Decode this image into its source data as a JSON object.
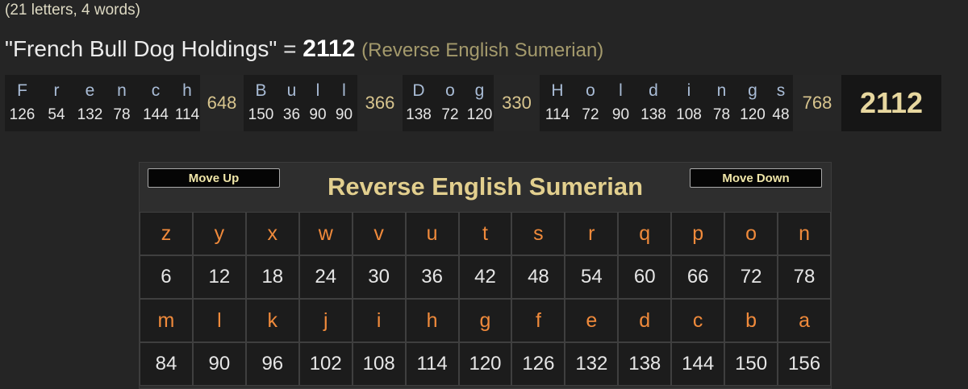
{
  "meta_text": "(21 letters, 4 words)",
  "phrase": {
    "quoted": "\"French Bull Dog Holdings\"",
    "equals": "=",
    "total": "2112",
    "cipher_label": "(Reverse English Sumerian)"
  },
  "breakdown": {
    "words": [
      {
        "letters": [
          {
            "ch": "F",
            "val": "126"
          },
          {
            "ch": "r",
            "val": "54"
          },
          {
            "ch": "e",
            "val": "132"
          },
          {
            "ch": "n",
            "val": "78"
          },
          {
            "ch": "c",
            "val": "144"
          },
          {
            "ch": "h",
            "val": "114"
          }
        ],
        "sum": "648"
      },
      {
        "letters": [
          {
            "ch": "B",
            "val": "150"
          },
          {
            "ch": "u",
            "val": "36"
          },
          {
            "ch": "l",
            "val": "90"
          },
          {
            "ch": "l",
            "val": "90"
          }
        ],
        "sum": "366"
      },
      {
        "letters": [
          {
            "ch": "D",
            "val": "138"
          },
          {
            "ch": "o",
            "val": "72"
          },
          {
            "ch": "g",
            "val": "120"
          }
        ],
        "sum": "330"
      },
      {
        "letters": [
          {
            "ch": "H",
            "val": "114"
          },
          {
            "ch": "o",
            "val": "72"
          },
          {
            "ch": "l",
            "val": "90"
          },
          {
            "ch": "d",
            "val": "138"
          },
          {
            "ch": "i",
            "val": "108"
          },
          {
            "ch": "n",
            "val": "78"
          },
          {
            "ch": "g",
            "val": "120"
          },
          {
            "ch": "s",
            "val": "48"
          }
        ],
        "sum": "768"
      }
    ],
    "grand_total": "2112"
  },
  "cipher_panel": {
    "move_up_label": "Move Up",
    "move_down_label": "Move Down",
    "title": "Reverse English Sumerian",
    "rows": [
      {
        "letters": [
          "z",
          "y",
          "x",
          "w",
          "v",
          "u",
          "t",
          "s",
          "r",
          "q",
          "p",
          "o",
          "n"
        ],
        "values": [
          "6",
          "12",
          "18",
          "24",
          "30",
          "36",
          "42",
          "48",
          "54",
          "60",
          "66",
          "72",
          "78"
        ]
      },
      {
        "letters": [
          "m",
          "l",
          "k",
          "j",
          "i",
          "h",
          "g",
          "f",
          "e",
          "d",
          "c",
          "b",
          "a"
        ],
        "values": [
          "84",
          "90",
          "96",
          "102",
          "108",
          "114",
          "120",
          "126",
          "132",
          "138",
          "144",
          "150",
          "156"
        ]
      }
    ]
  }
}
